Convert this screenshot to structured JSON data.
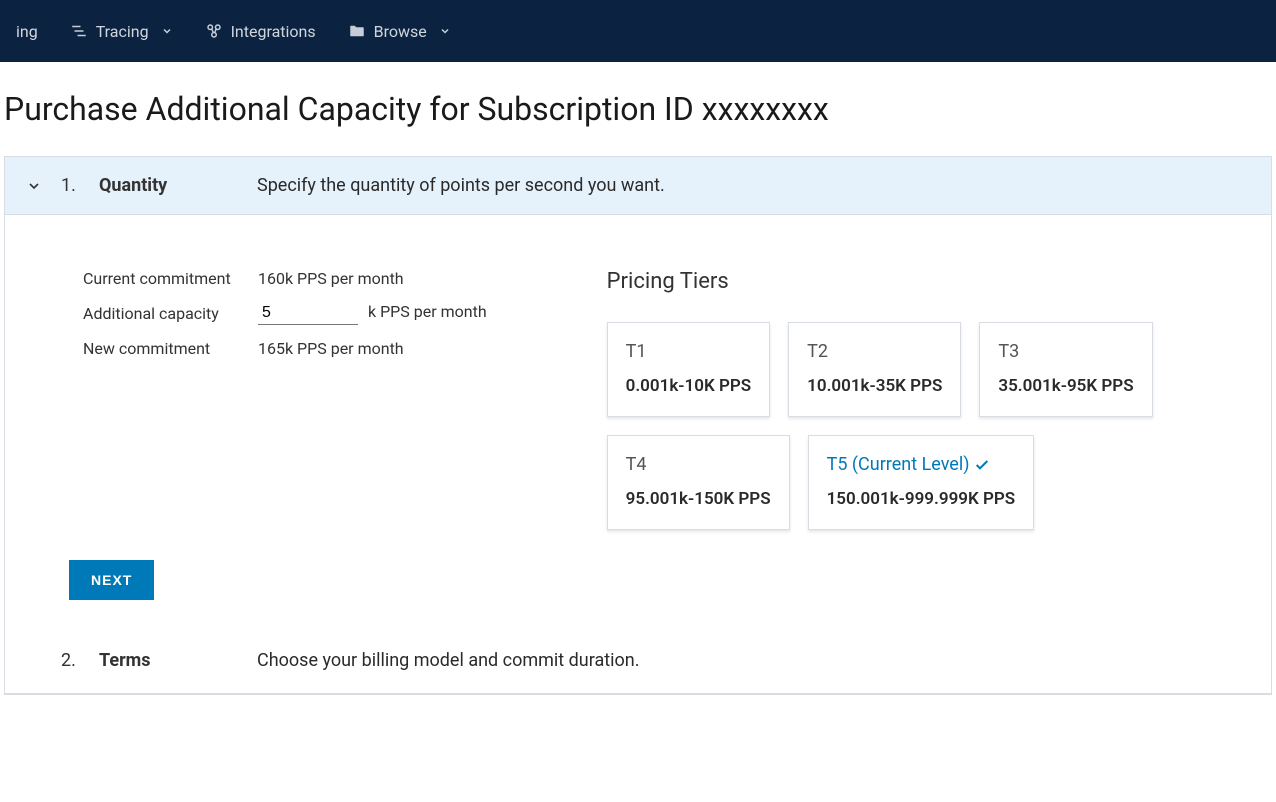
{
  "nav": {
    "item0_partial": "ing",
    "tracing": "Tracing",
    "integrations": "Integrations",
    "browse": "Browse"
  },
  "page": {
    "title_prefix": "Purchase Additional Capacity for Subscription ID ",
    "subscription_id": "xxxxxxxx"
  },
  "steps": {
    "quantity": {
      "num": "1.",
      "title": "Quantity",
      "desc": "Specify the quantity of points per second you want.",
      "current_commitment_label": "Current commitment",
      "current_commitment_value": "160k PPS per month",
      "additional_capacity_label": "Additional capacity",
      "additional_capacity_value": "5",
      "additional_capacity_suffix": "k PPS per month",
      "new_commitment_label": "New commitment",
      "new_commitment_value": "165k PPS per month",
      "next_button": "NEXT"
    },
    "terms": {
      "num": "2.",
      "title": "Terms",
      "desc": "Choose your billing model and commit duration."
    }
  },
  "tiers": {
    "heading": "Pricing Tiers",
    "items": [
      {
        "name": "T1",
        "range": "0.001k-10K PPS",
        "current": false
      },
      {
        "name": "T2",
        "range": "10.001k-35K PPS",
        "current": false
      },
      {
        "name": "T3",
        "range": "35.001k-95K PPS",
        "current": false
      },
      {
        "name": "T4",
        "range": "95.001k-150K PPS",
        "current": false
      },
      {
        "name": "T5 (Current Level)",
        "range": "150.001k-999.999K PPS",
        "current": true
      }
    ]
  }
}
